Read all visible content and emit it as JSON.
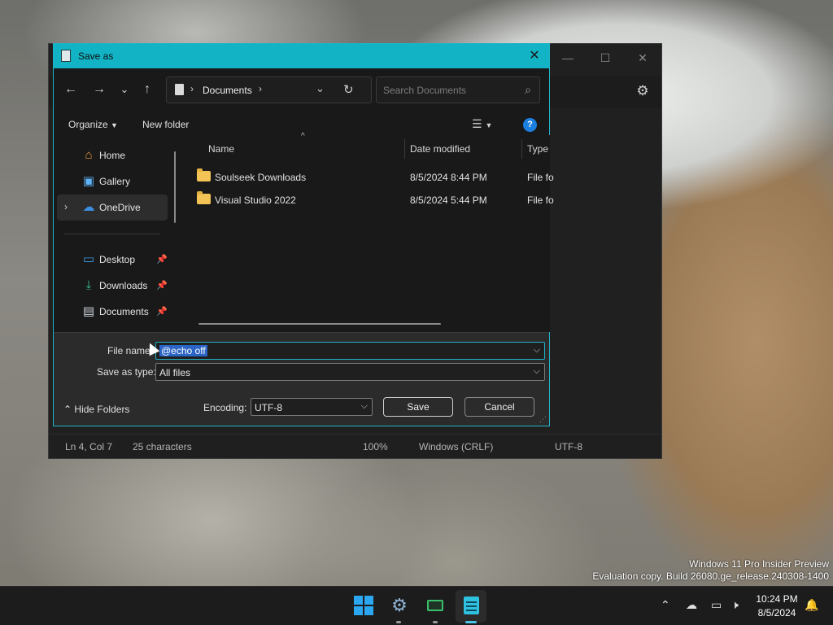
{
  "bg_window": {
    "status": {
      "position": "Ln 4, Col 7",
      "chars": "25 characters",
      "zoom": "100%",
      "line_ending": "Windows (CRLF)",
      "encoding": "UTF-8"
    },
    "caption": {
      "minimize": "—",
      "maximize": "☐",
      "close": "✕"
    },
    "settings_icon": "gear-icon"
  },
  "dialog": {
    "title": "Save as",
    "close": "✕",
    "nav": {
      "back": "←",
      "forward": "→",
      "recent": "⌄",
      "up": "↑"
    },
    "address": {
      "crumb": "Documents"
    },
    "search": {
      "placeholder": "Search Documents"
    },
    "commands": {
      "organize": "Organize",
      "new_folder": "New folder"
    },
    "sidebar": {
      "items": [
        {
          "label": "Home",
          "icon": "home-icon"
        },
        {
          "label": "Gallery",
          "icon": "gallery-icon"
        },
        {
          "label": "OneDrive",
          "icon": "cloud-icon",
          "selected": true
        },
        {
          "label": "Desktop",
          "icon": "desktop-icon",
          "pinned": true
        },
        {
          "label": "Downloads",
          "icon": "download-icon",
          "pinned": true
        },
        {
          "label": "Documents",
          "icon": "document-icon",
          "pinned": true
        }
      ]
    },
    "columns": {
      "name": "Name",
      "date": "Date modified",
      "type": "Type"
    },
    "files": [
      {
        "name": "Soulseek Downloads",
        "date": "8/5/2024 8:44 PM",
        "type": "File fo"
      },
      {
        "name": "Visual Studio 2022",
        "date": "8/5/2024 5:44 PM",
        "type": "File fo"
      }
    ],
    "form": {
      "filename_label": "File name:",
      "filename_value": "@echo off",
      "type_label": "Save as type:",
      "type_value": "All files",
      "encoding_label": "Encoding:",
      "encoding_value": "UTF-8",
      "hide_folders": "Hide Folders",
      "save": "Save",
      "cancel": "Cancel"
    }
  },
  "watermark": {
    "line1": "Windows 11 Pro Insider Preview",
    "line2": "Evaluation copy. Build 26080.ge_release.240308-1400"
  },
  "taskbar": {
    "clock_time": "10:24 PM",
    "clock_date": "8/5/2024",
    "apps": [
      "windows-start-icon",
      "settings-icon",
      "task-manager-icon",
      "notepad-icon"
    ]
  }
}
